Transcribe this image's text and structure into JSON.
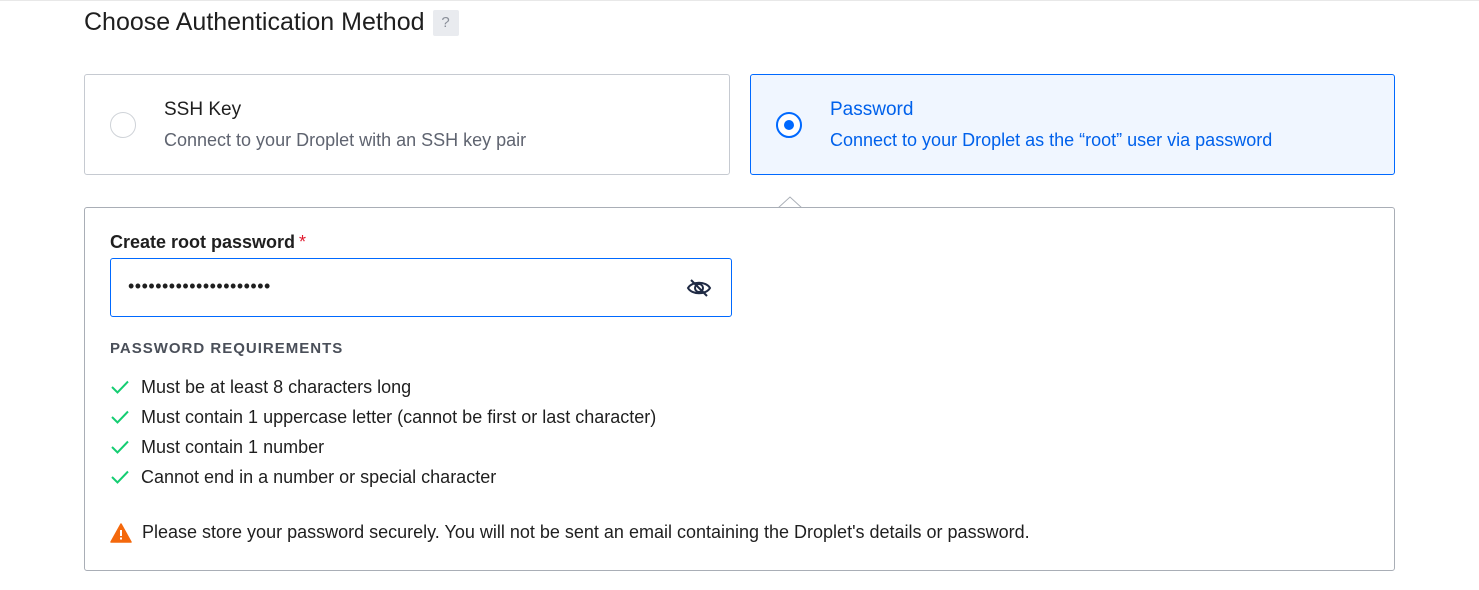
{
  "section": {
    "title": "Choose Authentication Method",
    "help_label": "?"
  },
  "options": [
    {
      "title": "SSH Key",
      "description": "Connect to your Droplet with an SSH key pair",
      "selected": false
    },
    {
      "title": "Password",
      "description": "Connect to your Droplet as the “root” user via password",
      "selected": true
    }
  ],
  "password_field": {
    "label": "Create root password",
    "required_mark": "*",
    "value_display": "•••••••••••••••••••••",
    "toggle_icon": "eye-slash-icon"
  },
  "requirements": {
    "heading": "PASSWORD REQUIREMENTS",
    "items": [
      {
        "text": "Must be at least 8 characters long",
        "met": true
      },
      {
        "text": "Must contain 1 uppercase letter (cannot be first or last character)",
        "met": true
      },
      {
        "text": "Must contain 1 number",
        "met": true
      },
      {
        "text": "Cannot end in a number or special character",
        "met": true
      }
    ]
  },
  "warning": {
    "icon": "warning-triangle-icon",
    "text": "Please store your password securely. You will not be sent an email containing the Droplet's details or password."
  },
  "colors": {
    "accent": "#0069ff",
    "selected_bg": "#f0f6ff",
    "check_green": "#15cd72",
    "warning_orange": "#f4680c",
    "required_red": "#e0192e"
  }
}
